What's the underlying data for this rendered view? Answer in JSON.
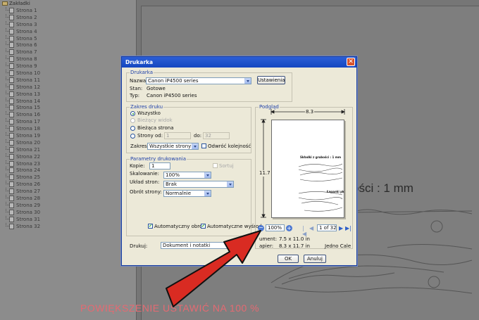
{
  "sidebar": {
    "header": "Zakładki",
    "items": [
      "Strona 1",
      "Strona 2",
      "Strona 3",
      "Strona 4",
      "Strona 5",
      "Strona 6",
      "Strona 7",
      "Strona 8",
      "Strona 9",
      "Strona 10",
      "Strona 11",
      "Strona 12",
      "Strona 13",
      "Strona 14",
      "Strona 15",
      "Strona 16",
      "Strona 17",
      "Strona 18",
      "Strona 19",
      "Strona 20",
      "Strona 21",
      "Strona 22",
      "Strona 23",
      "Strona 24",
      "Strona 25",
      "Strona 26",
      "Strona 27",
      "Strona 28",
      "Strona 29",
      "Strona 30",
      "Strona 31",
      "Strona 32"
    ]
  },
  "background": {
    "visible_title": "ości : 1 mm",
    "caption": "POWIĘKSZENIE USTAWIĆ NA 100 %"
  },
  "dialog": {
    "title": "Drukarka",
    "printer": {
      "group": "Drukarka",
      "name_label": "Nazwa:",
      "name_value": "Canon iP4500 series",
      "props_button": "Ustawienia",
      "status_label": "Stan:",
      "status_value": "Gotowe",
      "type_label": "Typ:",
      "type_value": "Canon iP4500 series"
    },
    "range": {
      "group": "Zakres druku",
      "all": "Wszystko",
      "current_view": "Bieżący widok",
      "current_page": "Bieżąca strona",
      "pages_from": "Strony od:",
      "from_value": "1",
      "to_label": "do:",
      "to_value": "32",
      "subset_label": "Zakres:",
      "subset_value": "Wszystkie strony z zak",
      "reverse": "Odwróć kolejność"
    },
    "handling": {
      "group": "Parametry drukowania",
      "copies_label": "Kopie:",
      "copies_value": "1",
      "collate": "Sortuj",
      "scaling_label": "Skalowanie:",
      "scaling_value": "100%",
      "layout_label": "Układ stron:",
      "layout_value": "Brak",
      "rotation_label": "Obrót strony:",
      "rotation_value": "Normalnie",
      "auto_rotate": "Automatyczny obrót",
      "auto_center": "Automatyczne wyśrod"
    },
    "print_what_label": "Drukuj:",
    "print_what_value": "Dokument i notatki",
    "preview": {
      "group": "Podgląd",
      "width_value": "8.3",
      "height_value": "11.7",
      "sheet_heading": "Składki z grubości : 1 mm",
      "sheet_line": "Łapanki pk",
      "zoom_value": "100%",
      "page_value": "1 of 32",
      "document_label": "ument:",
      "document_size": "7.5 x 11.0 in",
      "paper_label": "apier:",
      "paper_size": "8.3 x 11.7 in",
      "units_label": "Jedno Cale"
    },
    "ok_button": "OK",
    "cancel_button": "Anuluj"
  },
  "colors": {
    "caption": "#e46a72",
    "arrow": "#d92b22",
    "title_bar": "#1e50cc"
  },
  "icons": [
    "folder-icon",
    "page-icon",
    "close-icon",
    "zoom-out-icon",
    "zoom-in-icon",
    "first-page-icon",
    "prev-page-icon",
    "next-page-icon",
    "last-page-icon",
    "arrow-icon"
  ]
}
